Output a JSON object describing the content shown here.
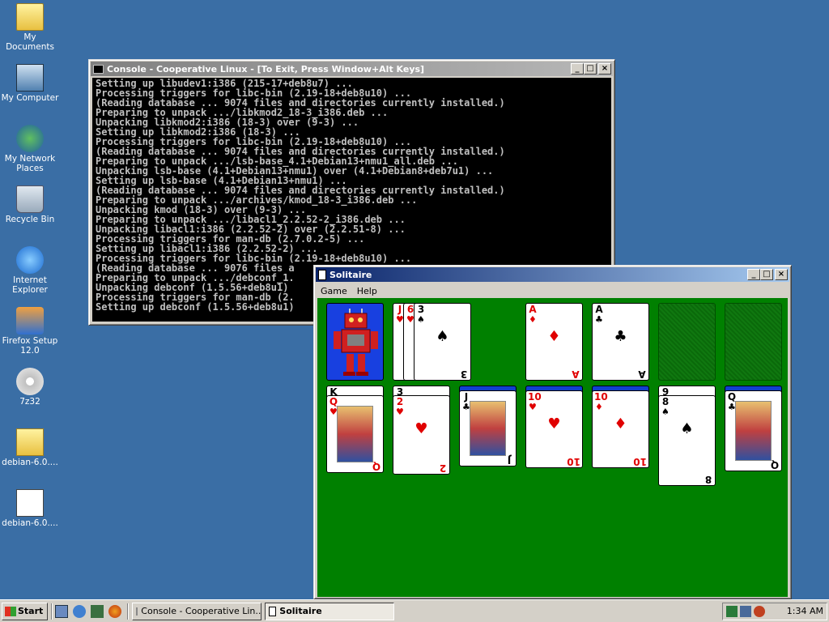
{
  "desktop": {
    "icons": [
      {
        "label": "My Documents",
        "icon": "folder-documents-icon"
      },
      {
        "label": "My Computer",
        "icon": "computer-icon"
      },
      {
        "label": "My Network Places",
        "icon": "network-icon"
      },
      {
        "label": "Recycle Bin",
        "icon": "recycle-bin-icon"
      },
      {
        "label": "Internet Explorer",
        "icon": "ie-icon"
      },
      {
        "label": "Firefox Setup 12.0",
        "icon": "installer-icon"
      },
      {
        "label": "7z32",
        "icon": "cd-installer-icon"
      },
      {
        "label": "debian-6.0....",
        "icon": "folder-icon"
      },
      {
        "label": "debian-6.0....",
        "icon": "file-icon"
      }
    ]
  },
  "console": {
    "title": "Console - Cooperative Linux - [To Exit, Press Window+Alt Keys]",
    "lines": [
      "Setting up libudev1:i386 (215-17+deb8u7) ...",
      "Processing triggers for libc-bin (2.19-18+deb8u10) ...",
      "(Reading database ... 9074 files and directories currently installed.)",
      "Preparing to unpack .../libkmod2_18-3_i386.deb ...",
      "Unpacking libkmod2:i386 (18-3) over (9-3) ...",
      "Setting up libkmod2:i386 (18-3) ...",
      "Processing triggers for libc-bin (2.19-18+deb8u10) ...",
      "(Reading database ... 9074 files and directories currently installed.)",
      "Preparing to unpack .../lsb-base_4.1+Debian13+nmu1_all.deb ...",
      "Unpacking lsb-base (4.1+Debian13+nmu1) over (4.1+Debian8+deb7u1) ...",
      "Setting up lsb-base (4.1+Debian13+nmu1) ...",
      "(Reading database ... 9074 files and directories currently installed.)",
      "Preparing to unpack .../archives/kmod_18-3_i386.deb ...",
      "Unpacking kmod (18-3) over (9-3) ...",
      "Preparing to unpack .../libacl1_2.2.52-2_i386.deb ...",
      "Unpacking libacl1:i386 (2.2.52-2) over (2.2.51-8) ...",
      "Processing triggers for man-db (2.7.0.2-5) ...",
      "Setting up libacl1:i386 (2.2.52-2) ...",
      "Processing triggers for libc-bin (2.19-18+deb8u10) ...",
      "(Reading database ... 9076 files a",
      "Preparing to unpack .../debconf_1.",
      "Unpacking debconf (1.5.56+deb8u1)",
      "Processing triggers for man-db (2.",
      "Setting up debconf (1.5.56+deb8u1)"
    ]
  },
  "solitaire": {
    "title": "Solitaire",
    "menu": [
      "Game",
      "Help"
    ],
    "waste": [
      {
        "rank": "J",
        "suit": "♥",
        "color": "red"
      },
      {
        "rank": "6",
        "suit": "♥",
        "color": "red"
      },
      {
        "rank": "3",
        "suit": "♠",
        "color": "black"
      }
    ],
    "foundations": [
      {
        "rank": "A",
        "suit": "♦",
        "color": "red"
      },
      {
        "rank": "A",
        "suit": "♣",
        "color": "black"
      }
    ],
    "tableau": [
      {
        "top": "K",
        "rank": "Q",
        "suit": "♥",
        "color": "red"
      },
      {
        "top": "3",
        "rank": "2",
        "suit": "♥",
        "color": "red"
      },
      {
        "top": "",
        "rank": "J",
        "suit": "♣",
        "color": "black"
      },
      {
        "top": "",
        "rank": "10",
        "suit": "♥",
        "color": "red"
      },
      {
        "top": "",
        "rank": "10",
        "suit": "♦",
        "color": "red"
      },
      {
        "top": "9",
        "rank": "8",
        "suit": "♠",
        "color": "black"
      },
      {
        "top": "",
        "rank": "Q",
        "suit": "♣",
        "color": "black"
      }
    ]
  },
  "taskbar": {
    "start_label": "Start",
    "tasks": [
      "Console - Cooperative Lin...",
      "Solitaire"
    ],
    "clock": "1:34 AM"
  }
}
